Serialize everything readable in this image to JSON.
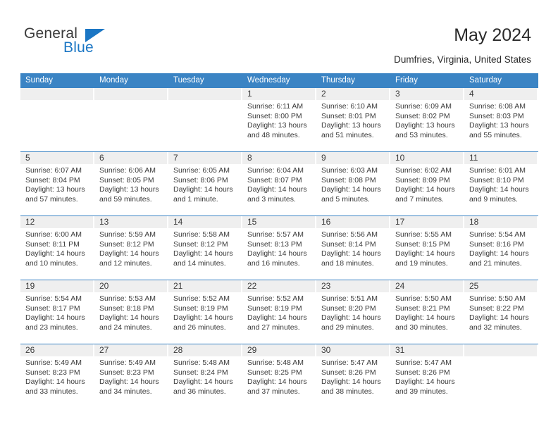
{
  "brand": {
    "name_top": "General",
    "name_bottom": "Blue",
    "accent_color": "#1b76c4"
  },
  "header": {
    "title": "May 2024",
    "subtitle": "Dumfries, Virginia, United States"
  },
  "calendar": {
    "header_color": "#3b84c4",
    "day_strip_color": "#efefef",
    "weekday_headers": [
      "Sunday",
      "Monday",
      "Tuesday",
      "Wednesday",
      "Thursday",
      "Friday",
      "Saturday"
    ],
    "weeks": [
      [
        {
          "day": "",
          "empty": true,
          "sunrise": "",
          "sunset": "",
          "daylight_1": "",
          "daylight_2": ""
        },
        {
          "day": "",
          "empty": true,
          "sunrise": "",
          "sunset": "",
          "daylight_1": "",
          "daylight_2": ""
        },
        {
          "day": "",
          "empty": true,
          "sunrise": "",
          "sunset": "",
          "daylight_1": "",
          "daylight_2": ""
        },
        {
          "day": "1",
          "sunrise": "Sunrise: 6:11 AM",
          "sunset": "Sunset: 8:00 PM",
          "daylight_1": "Daylight: 13 hours",
          "daylight_2": "and 48 minutes."
        },
        {
          "day": "2",
          "sunrise": "Sunrise: 6:10 AM",
          "sunset": "Sunset: 8:01 PM",
          "daylight_1": "Daylight: 13 hours",
          "daylight_2": "and 51 minutes."
        },
        {
          "day": "3",
          "sunrise": "Sunrise: 6:09 AM",
          "sunset": "Sunset: 8:02 PM",
          "daylight_1": "Daylight: 13 hours",
          "daylight_2": "and 53 minutes."
        },
        {
          "day": "4",
          "sunrise": "Sunrise: 6:08 AM",
          "sunset": "Sunset: 8:03 PM",
          "daylight_1": "Daylight: 13 hours",
          "daylight_2": "and 55 minutes."
        }
      ],
      [
        {
          "day": "5",
          "sunrise": "Sunrise: 6:07 AM",
          "sunset": "Sunset: 8:04 PM",
          "daylight_1": "Daylight: 13 hours",
          "daylight_2": "and 57 minutes."
        },
        {
          "day": "6",
          "sunrise": "Sunrise: 6:06 AM",
          "sunset": "Sunset: 8:05 PM",
          "daylight_1": "Daylight: 13 hours",
          "daylight_2": "and 59 minutes."
        },
        {
          "day": "7",
          "sunrise": "Sunrise: 6:05 AM",
          "sunset": "Sunset: 8:06 PM",
          "daylight_1": "Daylight: 14 hours",
          "daylight_2": "and 1 minute."
        },
        {
          "day": "8",
          "sunrise": "Sunrise: 6:04 AM",
          "sunset": "Sunset: 8:07 PM",
          "daylight_1": "Daylight: 14 hours",
          "daylight_2": "and 3 minutes."
        },
        {
          "day": "9",
          "sunrise": "Sunrise: 6:03 AM",
          "sunset": "Sunset: 8:08 PM",
          "daylight_1": "Daylight: 14 hours",
          "daylight_2": "and 5 minutes."
        },
        {
          "day": "10",
          "sunrise": "Sunrise: 6:02 AM",
          "sunset": "Sunset: 8:09 PM",
          "daylight_1": "Daylight: 14 hours",
          "daylight_2": "and 7 minutes."
        },
        {
          "day": "11",
          "sunrise": "Sunrise: 6:01 AM",
          "sunset": "Sunset: 8:10 PM",
          "daylight_1": "Daylight: 14 hours",
          "daylight_2": "and 9 minutes."
        }
      ],
      [
        {
          "day": "12",
          "sunrise": "Sunrise: 6:00 AM",
          "sunset": "Sunset: 8:11 PM",
          "daylight_1": "Daylight: 14 hours",
          "daylight_2": "and 10 minutes."
        },
        {
          "day": "13",
          "sunrise": "Sunrise: 5:59 AM",
          "sunset": "Sunset: 8:12 PM",
          "daylight_1": "Daylight: 14 hours",
          "daylight_2": "and 12 minutes."
        },
        {
          "day": "14",
          "sunrise": "Sunrise: 5:58 AM",
          "sunset": "Sunset: 8:12 PM",
          "daylight_1": "Daylight: 14 hours",
          "daylight_2": "and 14 minutes."
        },
        {
          "day": "15",
          "sunrise": "Sunrise: 5:57 AM",
          "sunset": "Sunset: 8:13 PM",
          "daylight_1": "Daylight: 14 hours",
          "daylight_2": "and 16 minutes."
        },
        {
          "day": "16",
          "sunrise": "Sunrise: 5:56 AM",
          "sunset": "Sunset: 8:14 PM",
          "daylight_1": "Daylight: 14 hours",
          "daylight_2": "and 18 minutes."
        },
        {
          "day": "17",
          "sunrise": "Sunrise: 5:55 AM",
          "sunset": "Sunset: 8:15 PM",
          "daylight_1": "Daylight: 14 hours",
          "daylight_2": "and 19 minutes."
        },
        {
          "day": "18",
          "sunrise": "Sunrise: 5:54 AM",
          "sunset": "Sunset: 8:16 PM",
          "daylight_1": "Daylight: 14 hours",
          "daylight_2": "and 21 minutes."
        }
      ],
      [
        {
          "day": "19",
          "sunrise": "Sunrise: 5:54 AM",
          "sunset": "Sunset: 8:17 PM",
          "daylight_1": "Daylight: 14 hours",
          "daylight_2": "and 23 minutes."
        },
        {
          "day": "20",
          "sunrise": "Sunrise: 5:53 AM",
          "sunset": "Sunset: 8:18 PM",
          "daylight_1": "Daylight: 14 hours",
          "daylight_2": "and 24 minutes."
        },
        {
          "day": "21",
          "sunrise": "Sunrise: 5:52 AM",
          "sunset": "Sunset: 8:19 PM",
          "daylight_1": "Daylight: 14 hours",
          "daylight_2": "and 26 minutes."
        },
        {
          "day": "22",
          "sunrise": "Sunrise: 5:52 AM",
          "sunset": "Sunset: 8:19 PM",
          "daylight_1": "Daylight: 14 hours",
          "daylight_2": "and 27 minutes."
        },
        {
          "day": "23",
          "sunrise": "Sunrise: 5:51 AM",
          "sunset": "Sunset: 8:20 PM",
          "daylight_1": "Daylight: 14 hours",
          "daylight_2": "and 29 minutes."
        },
        {
          "day": "24",
          "sunrise": "Sunrise: 5:50 AM",
          "sunset": "Sunset: 8:21 PM",
          "daylight_1": "Daylight: 14 hours",
          "daylight_2": "and 30 minutes."
        },
        {
          "day": "25",
          "sunrise": "Sunrise: 5:50 AM",
          "sunset": "Sunset: 8:22 PM",
          "daylight_1": "Daylight: 14 hours",
          "daylight_2": "and 32 minutes."
        }
      ],
      [
        {
          "day": "26",
          "sunrise": "Sunrise: 5:49 AM",
          "sunset": "Sunset: 8:23 PM",
          "daylight_1": "Daylight: 14 hours",
          "daylight_2": "and 33 minutes."
        },
        {
          "day": "27",
          "sunrise": "Sunrise: 5:49 AM",
          "sunset": "Sunset: 8:23 PM",
          "daylight_1": "Daylight: 14 hours",
          "daylight_2": "and 34 minutes."
        },
        {
          "day": "28",
          "sunrise": "Sunrise: 5:48 AM",
          "sunset": "Sunset: 8:24 PM",
          "daylight_1": "Daylight: 14 hours",
          "daylight_2": "and 36 minutes."
        },
        {
          "day": "29",
          "sunrise": "Sunrise: 5:48 AM",
          "sunset": "Sunset: 8:25 PM",
          "daylight_1": "Daylight: 14 hours",
          "daylight_2": "and 37 minutes."
        },
        {
          "day": "30",
          "sunrise": "Sunrise: 5:47 AM",
          "sunset": "Sunset: 8:26 PM",
          "daylight_1": "Daylight: 14 hours",
          "daylight_2": "and 38 minutes."
        },
        {
          "day": "31",
          "sunrise": "Sunrise: 5:47 AM",
          "sunset": "Sunset: 8:26 PM",
          "daylight_1": "Daylight: 14 hours",
          "daylight_2": "and 39 minutes."
        },
        {
          "day": "",
          "empty": true,
          "sunrise": "",
          "sunset": "",
          "daylight_1": "",
          "daylight_2": ""
        }
      ]
    ]
  }
}
